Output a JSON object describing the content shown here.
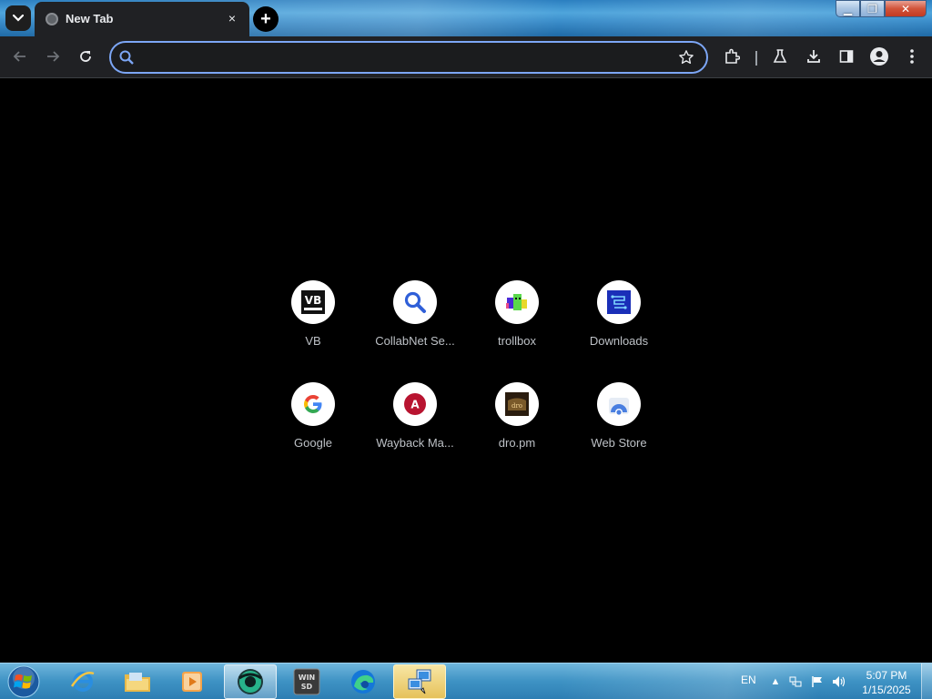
{
  "browser": {
    "tab": {
      "title": "New Tab",
      "favicon": "globe-icon",
      "close": "×"
    },
    "new_tab_label": "+",
    "window_controls": {
      "minimize": "▁",
      "maximize": "❐",
      "close": "✕"
    },
    "omnibox": {
      "value": "",
      "placeholder": ""
    },
    "toolbar_icons": [
      "back-icon",
      "forward-icon",
      "reload-icon",
      "star-icon",
      "extensions-icon",
      "labs-icon",
      "download-icon",
      "side-panel-icon",
      "profile-icon",
      "menu-icon"
    ]
  },
  "shortcuts": [
    {
      "label": "VB",
      "icon": "vb-icon"
    },
    {
      "label": "CollabNet Se...",
      "icon": "search-icon"
    },
    {
      "label": "trollbox",
      "icon": "trollbox-icon"
    },
    {
      "label": "Downloads",
      "icon": "downloads-icon"
    },
    {
      "label": "Google",
      "icon": "google-icon"
    },
    {
      "label": "Wayback Ma...",
      "icon": "wayback-icon"
    },
    {
      "label": "dro.pm",
      "icon": "dropm-icon"
    },
    {
      "label": "Web Store",
      "icon": "webstore-icon"
    }
  ],
  "taskbar": {
    "apps": [
      "start-orb",
      "internet-explorer",
      "file-explorer",
      "media-player",
      "chrome-dev",
      "winsd",
      "edge",
      "network-setup"
    ],
    "tray": {
      "language": "EN",
      "time": "5:07 PM",
      "date": "1/15/2025"
    }
  },
  "colors": {
    "accent": "#7ca6f5",
    "toolbar": "#202124",
    "content_bg": "#000000"
  }
}
